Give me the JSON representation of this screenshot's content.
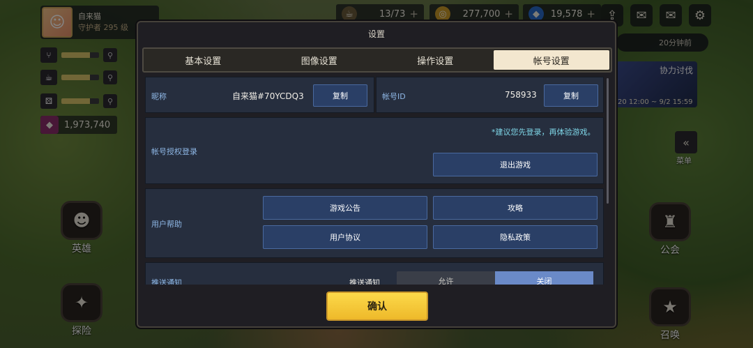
{
  "hud": {
    "player_name": "自来猫",
    "player_rank": "守护者 295 级",
    "stamina": "13/73",
    "gold": "277,700",
    "diamonds": "19,578",
    "gems": "1,973,740",
    "timer_text": "20分钟前",
    "event_title": "协力讨伐",
    "event_dates": "20 12:00 ~ 9/2 15:59",
    "menu_label": "菜单",
    "side_buttons": {
      "hero": "英雄",
      "explore": "探险",
      "guild": "公会",
      "summon": "召唤"
    }
  },
  "dialog": {
    "title": "设置",
    "tabs": [
      "基本设置",
      "图像设置",
      "操作设置",
      "帐号设置"
    ],
    "active_tab": 3,
    "nickname_label": "昵称",
    "nickname_value": "自来猫#70YCDQ3",
    "copy_label": "复制",
    "account_id_label": "帐号ID",
    "account_id_value": "758933",
    "auth_label": "帐号授权登录",
    "auth_hint": "*建议您先登录，再体验游戏。",
    "exit_label": "退出游戏",
    "help_label": "用户帮助",
    "help_buttons": [
      "游戏公告",
      "攻略",
      "用户协议",
      "隐私政策"
    ],
    "push_section_label": "推送通知",
    "push_row_label": "推送通知",
    "push_options": [
      "允许",
      "关闭"
    ],
    "push_selected": 1,
    "confirm_label": "确认"
  },
  "colors": {
    "accent": "#f3e7cf",
    "confirm": "#f5c93a",
    "label": "#8fb8e6",
    "hint": "#7fd7e8"
  }
}
